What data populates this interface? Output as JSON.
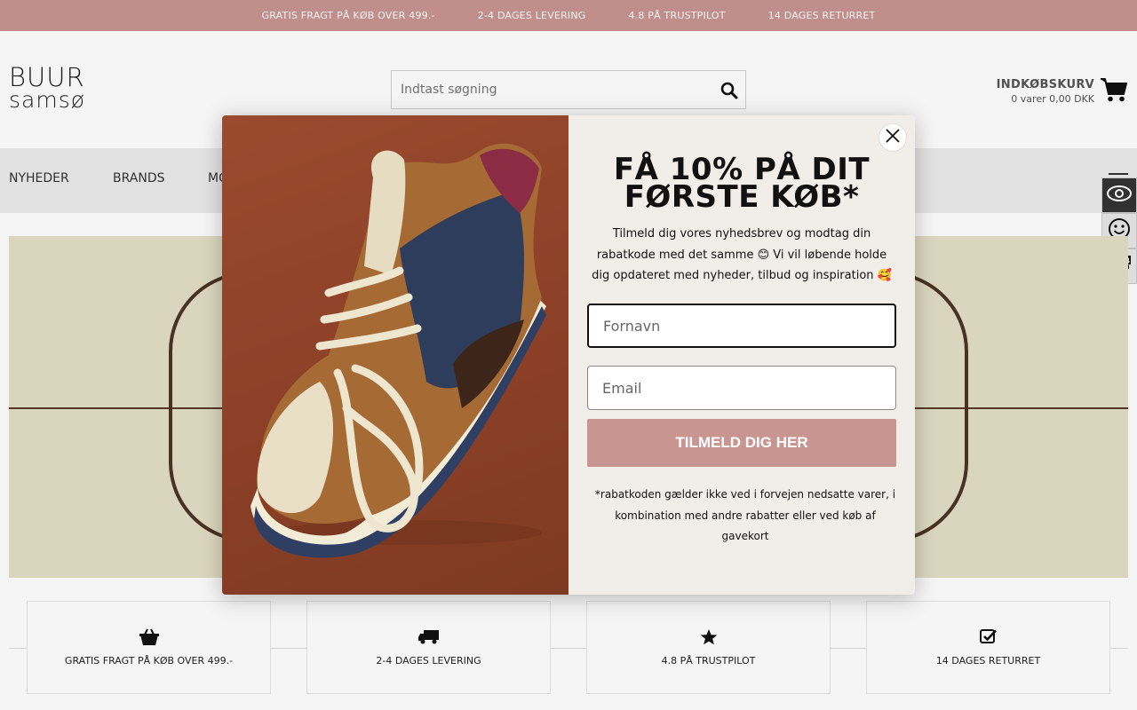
{
  "topbar": {
    "items": [
      "GRATIS FRAGT PÅ KØB OVER 499.-",
      "2-4 DAGES LEVERING",
      "4.8 PÅ TRUSTPILOT",
      "14 DAGES RETURRET"
    ]
  },
  "header": {
    "logo_line1": "BUUR",
    "logo_line2": "samsø",
    "search_placeholder": "Indtast søgning",
    "cart_title": "INDKØBSKURV",
    "cart_sub": "0 varer 0,00 DKK"
  },
  "nav": {
    "items": [
      "NYHEDER",
      "BRANDS",
      "MO"
    ]
  },
  "side_widgets": [
    "eye-icon",
    "smiley-icon",
    "delivery-24-icon"
  ],
  "usp": {
    "items": [
      {
        "icon": "basket-icon",
        "label": "GRATIS FRAGT PÅ KØB OVER 499.-"
      },
      {
        "icon": "truck-icon",
        "label": "2-4 DAGES LEVERING"
      },
      {
        "icon": "star-icon",
        "label": "4.8 PÅ TRUSTPILOT"
      },
      {
        "icon": "check-square-icon",
        "label": "14 DAGES RETURRET"
      }
    ]
  },
  "modal": {
    "title_line1": "FÅ 10% PÅ DIT",
    "title_line2": "FØRSTE KØB*",
    "subtitle": "Tilmeld dig vores nyhedsbrev og modtag din rabatkode med det samme 😊 Vi vil løbende holde dig opdateret med nyheder, tilbud og inspiration 🥰",
    "firstname_placeholder": "Fornavn",
    "email_placeholder": "Email",
    "button_label": "TILMELD DIG HER",
    "note": "*rabatkoden gælder ikke ved i forvejen nedsatte varer, i kombination med andre rabatter eller ved køb af gavekort"
  },
  "colors": {
    "accent": "#c99591",
    "nav_bg": "#ececec",
    "modal_bg": "#f1ede8",
    "banner_bg": "#e3dfc6"
  }
}
